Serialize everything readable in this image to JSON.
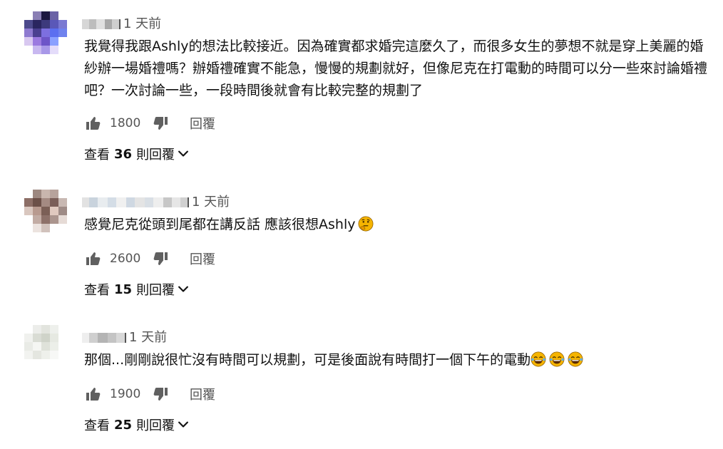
{
  "comments": [
    {
      "time": "1 天前",
      "text": "我覺得我跟Ashly的想法比較接近。因為確實都求婚完這麼久了，而很多女生的夢想不就是穿上美麗的婚紗辦一場婚禮嗎？辦婚禮確實不能急，慢慢的規劃就好，但像尼克在打電動的時間可以分一些來討論婚禮吧？一次討論一些，一段時間後就會有比較完整的規劃了",
      "likes": "1800",
      "reply_label": "回覆",
      "view_prefix": "查看",
      "reply_count": "36",
      "view_suffix": "則回覆"
    },
    {
      "time": "1 天前",
      "text": "感覺尼克從頭到尾都在講反話 應該很想Ashly",
      "likes": "2600",
      "reply_label": "回覆",
      "view_prefix": "查看",
      "reply_count": "15",
      "view_suffix": "則回覆"
    },
    {
      "time": "1 天前",
      "text": "那個...剛剛說很忙沒有時間可以規劃，可是後面說有時間打一個下午的電動",
      "likes": "1900",
      "reply_label": "回覆",
      "view_prefix": "查看",
      "reply_count": "25",
      "view_suffix": "則回覆"
    }
  ],
  "icons": {
    "like": "thumbs-up-icon",
    "dislike": "thumbs-down-icon",
    "expand": "chevron-down-icon",
    "thinking": "thinking-face-emoji",
    "laughing": "tears-of-joy-emoji"
  },
  "colors": {
    "icon": "#606060",
    "text": "#111111",
    "meta": "#555555",
    "emoji": "#f5b400"
  }
}
